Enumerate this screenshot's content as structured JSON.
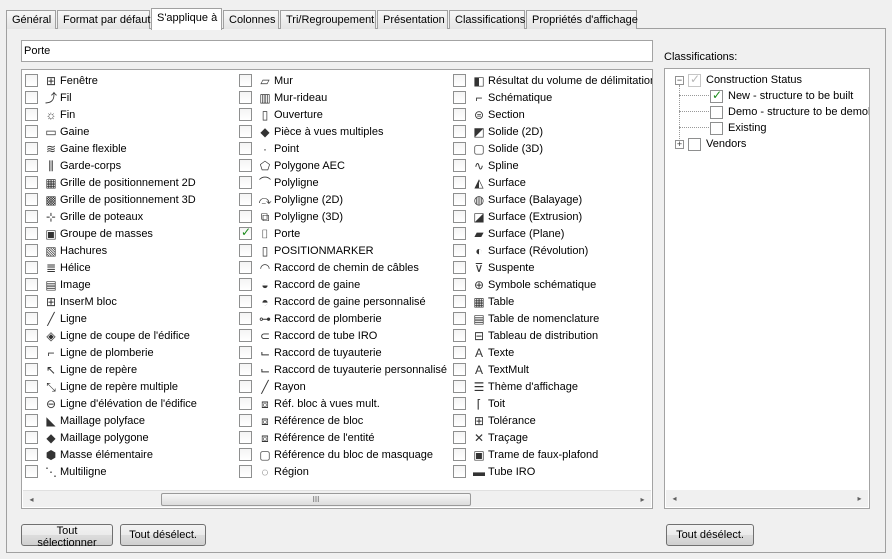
{
  "tabs": [
    {
      "label": "Général"
    },
    {
      "label": "Format par défaut"
    },
    {
      "label": "S'applique à"
    },
    {
      "label": "Colonnes"
    },
    {
      "label": "Tri/Regroupement"
    },
    {
      "label": "Présentation"
    },
    {
      "label": "Classifications"
    },
    {
      "label": "Propriétés d'affichage"
    }
  ],
  "filter": {
    "value": "Porte"
  },
  "objects": {
    "col1": [
      {
        "label": "Fenêtre",
        "icon": "window-icon",
        "glyph": "⊞",
        "checked": false
      },
      {
        "label": "Fil",
        "icon": "wire-icon",
        "glyph": "⤴",
        "checked": false
      },
      {
        "label": "Fin",
        "icon": "end-icon",
        "glyph": "☼",
        "checked": false
      },
      {
        "label": "Gaine",
        "icon": "duct-icon",
        "glyph": "▭",
        "checked": false
      },
      {
        "label": "Gaine flexible",
        "icon": "flex-duct-icon",
        "glyph": "≋",
        "checked": false
      },
      {
        "label": "Garde-corps",
        "icon": "railing-icon",
        "glyph": "⫼",
        "checked": false
      },
      {
        "label": "Grille de positionnement 2D",
        "icon": "grid-2d-icon",
        "glyph": "▦",
        "checked": false
      },
      {
        "label": "Grille de positionnement 3D",
        "icon": "grid-3d-icon",
        "glyph": "▩",
        "checked": false
      },
      {
        "label": "Grille de poteaux",
        "icon": "column-grid-icon",
        "glyph": "⊹",
        "checked": false
      },
      {
        "label": "Groupe de masses",
        "icon": "mass-group-icon",
        "glyph": "▣",
        "checked": false
      },
      {
        "label": "Hachures",
        "icon": "hatch-icon",
        "glyph": "▧",
        "checked": false
      },
      {
        "label": "Hélice",
        "icon": "helix-icon",
        "glyph": "≣",
        "checked": false
      },
      {
        "label": "Image",
        "icon": "image-icon",
        "glyph": "▤",
        "checked": false
      },
      {
        "label": "InserM bloc",
        "icon": "minsert-icon",
        "glyph": "⊞",
        "checked": false
      },
      {
        "label": "Ligne",
        "icon": "line-icon",
        "glyph": "╱",
        "checked": false
      },
      {
        "label": "Ligne de coupe de l'édifice",
        "icon": "section-line-icon",
        "glyph": "◈",
        "checked": false
      },
      {
        "label": "Ligne de plomberie",
        "icon": "plumbing-line-icon",
        "glyph": "⌐",
        "checked": false
      },
      {
        "label": "Ligne de repère",
        "icon": "leader-icon",
        "glyph": "↖",
        "checked": false
      },
      {
        "label": "Ligne de repère multiple",
        "icon": "multileader-icon",
        "glyph": "⤡",
        "checked": false
      },
      {
        "label": "Ligne d'élévation de l'édifice",
        "icon": "elevation-line-icon",
        "glyph": "⊖",
        "checked": false
      },
      {
        "label": "Maillage polyface",
        "icon": "polyface-mesh-icon",
        "glyph": "◣",
        "checked": false
      },
      {
        "label": "Maillage polygone",
        "icon": "polygon-mesh-icon",
        "glyph": "◆",
        "checked": false
      },
      {
        "label": "Masse élémentaire",
        "icon": "mass-element-icon",
        "glyph": "⬢",
        "checked": false
      },
      {
        "label": "Multiligne",
        "icon": "multiline-icon",
        "glyph": "⋱",
        "checked": false
      }
    ],
    "col2": [
      {
        "label": "Mur",
        "icon": "wall-icon",
        "glyph": "▱",
        "checked": false
      },
      {
        "label": "Mur-rideau",
        "icon": "curtain-wall-icon",
        "glyph": "▥",
        "checked": false
      },
      {
        "label": "Ouverture",
        "icon": "opening-icon",
        "glyph": "▯",
        "checked": false
      },
      {
        "label": "Pièce à vues multiples",
        "icon": "mvpart-icon",
        "glyph": "◆",
        "checked": false
      },
      {
        "label": "Point",
        "icon": "point-icon",
        "glyph": "·",
        "checked": false
      },
      {
        "label": "Polygone AEC",
        "icon": "aec-polygon-icon",
        "glyph": "⬠",
        "checked": false
      },
      {
        "label": "Polyligne",
        "icon": "polyline-icon",
        "glyph": "⌒",
        "checked": false
      },
      {
        "label": "Polyligne (2D)",
        "icon": "polyline-2d-icon",
        "glyph": "⤼",
        "checked": false
      },
      {
        "label": "Polyligne (3D)",
        "icon": "polyline-3d-icon",
        "glyph": "⧉",
        "checked": false
      },
      {
        "label": "Porte",
        "icon": "door-icon",
        "glyph": "⌷",
        "checked": true
      },
      {
        "label": "POSITIONMARKER",
        "icon": "position-marker-icon",
        "glyph": "▯",
        "checked": false
      },
      {
        "label": "Raccord de chemin de câbles",
        "icon": "cable-tray-fitting-icon",
        "glyph": "◠",
        "checked": false
      },
      {
        "label": "Raccord de gaine",
        "icon": "duct-fitting-icon",
        "glyph": "◒",
        "checked": false
      },
      {
        "label": "Raccord de gaine personnalisé",
        "icon": "custom-duct-fitting-icon",
        "glyph": "◓",
        "checked": false
      },
      {
        "label": "Raccord de plomberie",
        "icon": "plumbing-fitting-icon",
        "glyph": "⊶",
        "checked": false
      },
      {
        "label": "Raccord de tube IRO",
        "icon": "conduit-fitting-icon",
        "glyph": "⊂",
        "checked": false
      },
      {
        "label": "Raccord de tuyauterie",
        "icon": "pipe-fitting-icon",
        "glyph": "⌙",
        "checked": false
      },
      {
        "label": "Raccord de tuyauterie personnalisé",
        "icon": "custom-pipe-fitting-icon",
        "glyph": "⌙",
        "checked": false
      },
      {
        "label": "Rayon",
        "icon": "ray-icon",
        "glyph": "╱",
        "checked": false
      },
      {
        "label": "Réf. bloc à vues mult.",
        "icon": "mvblock-ref-icon",
        "glyph": "⧈",
        "checked": false
      },
      {
        "label": "Référence de bloc",
        "icon": "block-ref-icon",
        "glyph": "⧈",
        "checked": false
      },
      {
        "label": "Référence de l'entité",
        "icon": "entity-ref-icon",
        "glyph": "⧈",
        "checked": false
      },
      {
        "label": "Référence du bloc de masquage",
        "icon": "mask-block-ref-icon",
        "glyph": "▢",
        "checked": false
      },
      {
        "label": "Région",
        "icon": "region-icon",
        "glyph": "◌",
        "checked": false
      }
    ],
    "col3": [
      {
        "label": "Résultat du volume de délimitation",
        "icon": "bounding-volume-icon",
        "glyph": "◧",
        "checked": false
      },
      {
        "label": "Schématique",
        "icon": "schematic-icon",
        "glyph": "⌐",
        "checked": false
      },
      {
        "label": "Section",
        "icon": "section-icon",
        "glyph": "⊜",
        "checked": false
      },
      {
        "label": "Solide (2D)",
        "icon": "solid-2d-icon",
        "glyph": "◩",
        "checked": false
      },
      {
        "label": "Solide (3D)",
        "icon": "solid-3d-icon",
        "glyph": "▢",
        "checked": false
      },
      {
        "label": "Spline",
        "icon": "spline-icon",
        "glyph": "∿",
        "checked": false
      },
      {
        "label": "Surface",
        "icon": "surface-icon",
        "glyph": "◭",
        "checked": false
      },
      {
        "label": "Surface (Balayage)",
        "icon": "surface-sweep-icon",
        "glyph": "◍",
        "checked": false
      },
      {
        "label": "Surface (Extrusion)",
        "icon": "surface-extrude-icon",
        "glyph": "◪",
        "checked": false
      },
      {
        "label": "Surface (Plane)",
        "icon": "surface-plane-icon",
        "glyph": "▰",
        "checked": false
      },
      {
        "label": "Surface (Révolution)",
        "icon": "surface-revolve-icon",
        "glyph": "◐",
        "checked": false
      },
      {
        "label": "Suspente",
        "icon": "hanger-icon",
        "glyph": "⊽",
        "checked": false
      },
      {
        "label": "Symbole schématique",
        "icon": "schematic-symbol-icon",
        "glyph": "⊕",
        "checked": false
      },
      {
        "label": "Table",
        "icon": "table-icon",
        "glyph": "▦",
        "checked": false
      },
      {
        "label": "Table de nomenclature",
        "icon": "schedule-table-icon",
        "glyph": "▤",
        "checked": false
      },
      {
        "label": "Tableau de distribution",
        "icon": "panel-icon",
        "glyph": "⊟",
        "checked": false
      },
      {
        "label": "Texte",
        "icon": "text-icon",
        "glyph": "A",
        "checked": false
      },
      {
        "label": "TextMult",
        "icon": "mtext-icon",
        "glyph": "A",
        "checked": false
      },
      {
        "label": "Thème d'affichage",
        "icon": "display-theme-icon",
        "glyph": "☰",
        "checked": false
      },
      {
        "label": "Toit",
        "icon": "roof-icon",
        "glyph": "⌈",
        "checked": false
      },
      {
        "label": "Tolérance",
        "icon": "tolerance-icon",
        "glyph": "⊞",
        "checked": false
      },
      {
        "label": "Traçage",
        "icon": "trace-icon",
        "glyph": "✕",
        "checked": false
      },
      {
        "label": "Trame de faux-plafond",
        "icon": "ceiling-grid-icon",
        "glyph": "▣",
        "checked": false
      },
      {
        "label": "Tube IRO",
        "icon": "conduit-icon",
        "glyph": "▬",
        "checked": false
      }
    ]
  },
  "classifications": {
    "label": "Classifications:",
    "tree": [
      {
        "label": "Construction Status",
        "expander": "−",
        "checked": true,
        "grey": true
      },
      {
        "label": "New - structure to be built",
        "checked": true
      },
      {
        "label": "Demo - structure to be demolis",
        "checked": false
      },
      {
        "label": "Existing",
        "checked": false
      },
      {
        "label": "Vendors",
        "expander": "+",
        "checked": false
      }
    ]
  },
  "buttons": {
    "select_all": "Tout sélectionner",
    "deselect_all": "Tout désélect.",
    "class_deselect_all": "Tout désélect."
  },
  "scroll": {
    "left": "◂",
    "right": "▸",
    "grip": "III"
  }
}
